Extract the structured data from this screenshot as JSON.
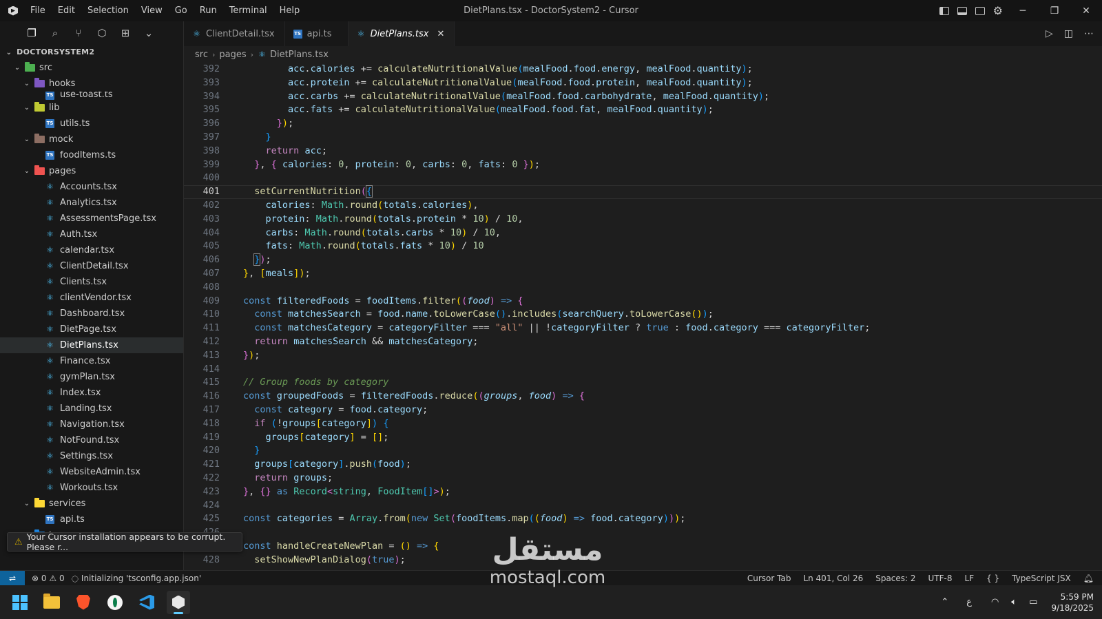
{
  "titlebar": {
    "menu": [
      "File",
      "Edit",
      "Selection",
      "View",
      "Go",
      "Run",
      "Terminal",
      "Help"
    ],
    "window_title": "DietPlans.tsx - DoctorSystem2 - Cursor"
  },
  "explorer": {
    "root": "DOCTORSYSTEM2",
    "rows": [
      {
        "label": "src",
        "type": "folder",
        "depth": 0,
        "open": true,
        "color": "#4caf50"
      },
      {
        "label": "hooks",
        "type": "folder",
        "depth": 1,
        "open": true,
        "color": "#7e57c2"
      },
      {
        "label": "use-toast.ts",
        "type": "ts",
        "depth": 2
      },
      {
        "label": "lib",
        "type": "folder",
        "depth": 1,
        "open": true,
        "color": "#c0ca33"
      },
      {
        "label": "utils.ts",
        "type": "ts",
        "depth": 2
      },
      {
        "label": "mock",
        "type": "folder",
        "depth": 1,
        "open": true,
        "color": "#8d6e63"
      },
      {
        "label": "foodItems.ts",
        "type": "ts",
        "depth": 2
      },
      {
        "label": "pages",
        "type": "folder",
        "depth": 1,
        "open": true,
        "color": "#ef5350"
      },
      {
        "label": "Accounts.tsx",
        "type": "react",
        "depth": 2
      },
      {
        "label": "Analytics.tsx",
        "type": "react",
        "depth": 2
      },
      {
        "label": "AssessmentsPage.tsx",
        "type": "react",
        "depth": 2
      },
      {
        "label": "Auth.tsx",
        "type": "react",
        "depth": 2
      },
      {
        "label": "calendar.tsx",
        "type": "react",
        "depth": 2
      },
      {
        "label": "ClientDetail.tsx",
        "type": "react",
        "depth": 2
      },
      {
        "label": "Clients.tsx",
        "type": "react",
        "depth": 2
      },
      {
        "label": "clientVendor.tsx",
        "type": "react",
        "depth": 2
      },
      {
        "label": "Dashboard.tsx",
        "type": "react",
        "depth": 2
      },
      {
        "label": "DietPage.tsx",
        "type": "react",
        "depth": 2
      },
      {
        "label": "DietPlans.tsx",
        "type": "react",
        "depth": 2,
        "selected": true
      },
      {
        "label": "Finance.tsx",
        "type": "react",
        "depth": 2
      },
      {
        "label": "gymPlan.tsx",
        "type": "react",
        "depth": 2
      },
      {
        "label": "Index.tsx",
        "type": "react",
        "depth": 2
      },
      {
        "label": "Landing.tsx",
        "type": "react",
        "depth": 2
      },
      {
        "label": "Navigation.tsx",
        "type": "react",
        "depth": 2
      },
      {
        "label": "NotFound.tsx",
        "type": "react",
        "depth": 2
      },
      {
        "label": "Settings.tsx",
        "type": "react",
        "depth": 2
      },
      {
        "label": "WebsiteAdmin.tsx",
        "type": "react",
        "depth": 2
      },
      {
        "label": "Workouts.tsx",
        "type": "react",
        "depth": 2
      },
      {
        "label": "services",
        "type": "folder",
        "depth": 1,
        "open": true,
        "color": "#fdd835"
      },
      {
        "label": "api.ts",
        "type": "ts",
        "depth": 2
      },
      {
        "label": "types",
        "type": "folder",
        "depth": 1,
        "open": false,
        "color": "#1e88e5"
      }
    ]
  },
  "notice": {
    "text": "Your Cursor installation appears to be corrupt. Please r..."
  },
  "tabs": [
    {
      "label": "ClientDetail.tsx",
      "icon": "react",
      "active": false
    },
    {
      "label": "api.ts",
      "icon": "ts",
      "active": false
    },
    {
      "label": "DietPlans.tsx",
      "icon": "react",
      "active": true
    }
  ],
  "breadcrumb": [
    "src",
    "pages",
    "DietPlans.tsx"
  ],
  "code": {
    "current_line": 401,
    "lines": [
      {
        "n": 392,
        "h": "        <span class=\"v\">acc</span>.<span class=\"v\">calories</span> += <span class=\"f\">calculateNutritionalValue</span><span class=\"b3\">(</span><span class=\"v\">mealFood</span>.<span class=\"v\">food</span>.<span class=\"v\">energy</span>, <span class=\"v\">mealFood</span>.<span class=\"v\">quantity</span><span class=\"b3\">)</span>;"
      },
      {
        "n": 393,
        "h": "        <span class=\"v\">acc</span>.<span class=\"v\">protein</span> += <span class=\"f\">calculateNutritionalValue</span><span class=\"b3\">(</span><span class=\"v\">mealFood</span>.<span class=\"v\">food</span>.<span class=\"v\">protein</span>, <span class=\"v\">mealFood</span>.<span class=\"v\">quantity</span><span class=\"b3\">)</span>;"
      },
      {
        "n": 394,
        "h": "        <span class=\"v\">acc</span>.<span class=\"v\">carbs</span> += <span class=\"f\">calculateNutritionalValue</span><span class=\"b3\">(</span><span class=\"v\">mealFood</span>.<span class=\"v\">food</span>.<span class=\"v\">carbohydrate</span>, <span class=\"v\">mealFood</span>.<span class=\"v\">quantity</span><span class=\"b3\">)</span>;"
      },
      {
        "n": 395,
        "h": "        <span class=\"v\">acc</span>.<span class=\"v\">fats</span> += <span class=\"f\">calculateNutritionalValue</span><span class=\"b3\">(</span><span class=\"v\">mealFood</span>.<span class=\"v\">food</span>.<span class=\"v\">fat</span>, <span class=\"v\">mealFood</span>.<span class=\"v\">quantity</span><span class=\"b3\">)</span>;"
      },
      {
        "n": 396,
        "h": "      <span class=\"b2\">}</span><span class=\"b1\">)</span>;"
      },
      {
        "n": 397,
        "h": "    <span class=\"b3\">}</span>"
      },
      {
        "n": 398,
        "h": "    <span class=\"c\">return</span> <span class=\"v\">acc</span>;"
      },
      {
        "n": 399,
        "h": "  <span class=\"b2\">}</span>, <span class=\"b2\">{</span> <span class=\"v\">calories</span>: <span class=\"n\">0</span>, <span class=\"v\">protein</span>: <span class=\"n\">0</span>, <span class=\"v\">carbs</span>: <span class=\"n\">0</span>, <span class=\"v\">fats</span>: <span class=\"n\">0</span> <span class=\"b2\">}</span><span class=\"b1\">)</span>;"
      },
      {
        "n": 400,
        "h": ""
      },
      {
        "n": 401,
        "h": "  <span class=\"f\">setCurrentNutrition</span><span class=\"b2\">(</span><span class=\"b3 bm\">{</span>"
      },
      {
        "n": 402,
        "h": "    <span class=\"v\">calories</span>: <span class=\"t\">Math</span>.<span class=\"f\">round</span><span class=\"b1\">(</span><span class=\"v\">totals</span>.<span class=\"v\">calories</span><span class=\"b1\">)</span>,"
      },
      {
        "n": 403,
        "h": "    <span class=\"v\">protein</span>: <span class=\"t\">Math</span>.<span class=\"f\">round</span><span class=\"b1\">(</span><span class=\"v\">totals</span>.<span class=\"v\">protein</span> * <span class=\"n\">10</span><span class=\"b1\">)</span> / <span class=\"n\">10</span>,"
      },
      {
        "n": 404,
        "h": "    <span class=\"v\">carbs</span>: <span class=\"t\">Math</span>.<span class=\"f\">round</span><span class=\"b1\">(</span><span class=\"v\">totals</span>.<span class=\"v\">carbs</span> * <span class=\"n\">10</span><span class=\"b1\">)</span> / <span class=\"n\">10</span>,"
      },
      {
        "n": 405,
        "h": "    <span class=\"v\">fats</span>: <span class=\"t\">Math</span>.<span class=\"f\">round</span><span class=\"b1\">(</span><span class=\"v\">totals</span>.<span class=\"v\">fats</span> * <span class=\"n\">10</span><span class=\"b1\">)</span> / <span class=\"n\">10</span>"
      },
      {
        "n": 406,
        "h": "  <span class=\"b3 bm\">}</span><span class=\"b2\">)</span>;"
      },
      {
        "n": 407,
        "h": "<span class=\"b1\">}</span>, <span class=\"b1\">[</span><span class=\"v\">meals</span><span class=\"b1\">]</span><span class=\"b1\">)</span>;"
      },
      {
        "n": 408,
        "h": ""
      },
      {
        "n": 409,
        "h": "<span class=\"k\">const</span> <span class=\"v\">filteredFoods</span> = <span class=\"v\">foodItems</span>.<span class=\"f\">filter</span><span class=\"b1\">(</span><span class=\"b2\">(</span><span class=\"p\">food</span><span class=\"b2\">)</span> <span class=\"k\">=&gt;</span> <span class=\"b2\">{</span>"
      },
      {
        "n": 410,
        "h": "  <span class=\"k\">const</span> <span class=\"v\">matchesSearch</span> = <span class=\"v\">food</span>.<span class=\"v\">name</span>.<span class=\"f\">toLowerCase</span><span class=\"b3\">()</span>.<span class=\"f\">includes</span><span class=\"b3\">(</span><span class=\"v\">searchQuery</span>.<span class=\"f\">toLowerCase</span><span class=\"b1\">()</span><span class=\"b3\">)</span>;"
      },
      {
        "n": 411,
        "h": "  <span class=\"k\">const</span> <span class=\"v\">matchesCategory</span> = <span class=\"v\">categoryFilter</span> === <span class=\"s\">\"all\"</span> || !<span class=\"v\">categoryFilter</span> ? <span class=\"k\">true</span> : <span class=\"v\">food</span>.<span class=\"v\">category</span> === <span class=\"v\">categoryFilter</span>;"
      },
      {
        "n": 412,
        "h": "  <span class=\"c\">return</span> <span class=\"v\">matchesSearch</span> &amp;&amp; <span class=\"v\">matchesCategory</span>;"
      },
      {
        "n": 413,
        "h": "<span class=\"b2\">}</span><span class=\"b1\">)</span>;"
      },
      {
        "n": 414,
        "h": ""
      },
      {
        "n": 415,
        "h": "<span class=\"cm\">// Group foods by category</span>"
      },
      {
        "n": 416,
        "h": "<span class=\"k\">const</span> <span class=\"v\">groupedFoods</span> = <span class=\"v\">filteredFoods</span>.<span class=\"f\">reduce</span><span class=\"b1\">(</span><span class=\"b2\">(</span><span class=\"p\">groups</span>, <span class=\"p\">food</span><span class=\"b2\">)</span> <span class=\"k\">=&gt;</span> <span class=\"b2\">{</span>"
      },
      {
        "n": 417,
        "h": "  <span class=\"k\">const</span> <span class=\"v\">category</span> = <span class=\"v\">food</span>.<span class=\"v\">category</span>;"
      },
      {
        "n": 418,
        "h": "  <span class=\"c\">if</span> <span class=\"b3\">(</span>!<span class=\"v\">groups</span><span class=\"b1\">[</span><span class=\"v\">category</span><span class=\"b1\">]</span><span class=\"b3\">)</span> <span class=\"b3\">{</span>"
      },
      {
        "n": 419,
        "h": "    <span class=\"v\">groups</span><span class=\"b1\">[</span><span class=\"v\">category</span><span class=\"b1\">]</span> = <span class=\"b1\">[]</span>;"
      },
      {
        "n": 420,
        "h": "  <span class=\"b3\">}</span>"
      },
      {
        "n": 421,
        "h": "  <span class=\"v\">groups</span><span class=\"b3\">[</span><span class=\"v\">category</span><span class=\"b3\">]</span>.<span class=\"f\">push</span><span class=\"b3\">(</span><span class=\"v\">food</span><span class=\"b3\">)</span>;"
      },
      {
        "n": 422,
        "h": "  <span class=\"c\">return</span> <span class=\"v\">groups</span>;"
      },
      {
        "n": 423,
        "h": "<span class=\"b2\">}</span>, <span class=\"b2\">{}</span> <span class=\"k\">as</span> <span class=\"t\">Record</span><span class=\"b2\">&lt;</span><span class=\"t\">string</span>, <span class=\"t\">FoodItem</span><span class=\"b3\">[]</span><span class=\"b2\">&gt;</span><span class=\"b1\">)</span>;"
      },
      {
        "n": 424,
        "h": ""
      },
      {
        "n": 425,
        "h": "<span class=\"k\">const</span> <span class=\"v\">categories</span> = <span class=\"t\">Array</span>.<span class=\"f\">from</span><span class=\"b1\">(</span><span class=\"k\">new</span> <span class=\"t\">Set</span><span class=\"b2\">(</span><span class=\"v\">foodItems</span>.<span class=\"f\">map</span><span class=\"b3\">(</span><span class=\"b1\">(</span><span class=\"p\">food</span><span class=\"b1\">)</span> <span class=\"k\">=&gt;</span> <span class=\"v\">food</span>.<span class=\"v\">category</span><span class=\"b3\">)</span><span class=\"b2\">)</span><span class=\"b1\">)</span>;"
      },
      {
        "n": 426,
        "h": ""
      },
      {
        "n": 427,
        "h": "<span class=\"k\">const</span> <span class=\"f\">handleCreateNewPlan</span> = <span class=\"b1\">()</span> <span class=\"k\">=&gt;</span> <span class=\"b1\">{</span>"
      },
      {
        "n": 428,
        "h": "  <span class=\"f\">setShowNewPlanDialog</span><span class=\"b2\">(</span><span class=\"k\">true</span><span class=\"b2\">)</span>;"
      }
    ]
  },
  "statusbar": {
    "errors": "0",
    "warnings": "0",
    "task": "Initializing 'tsconfig.app.json'",
    "cursor_tab": "Cursor Tab",
    "position": "Ln 401, Col 26",
    "spaces": "Spaces: 2",
    "encoding": "UTF-8",
    "eol": "LF",
    "language": "TypeScript JSX"
  },
  "watermark": {
    "arabic": "مستقل",
    "latin": "mostaql.com"
  },
  "taskbar": {
    "ime": "ع",
    "time": "5:59 PM",
    "date": "9/18/2025"
  }
}
